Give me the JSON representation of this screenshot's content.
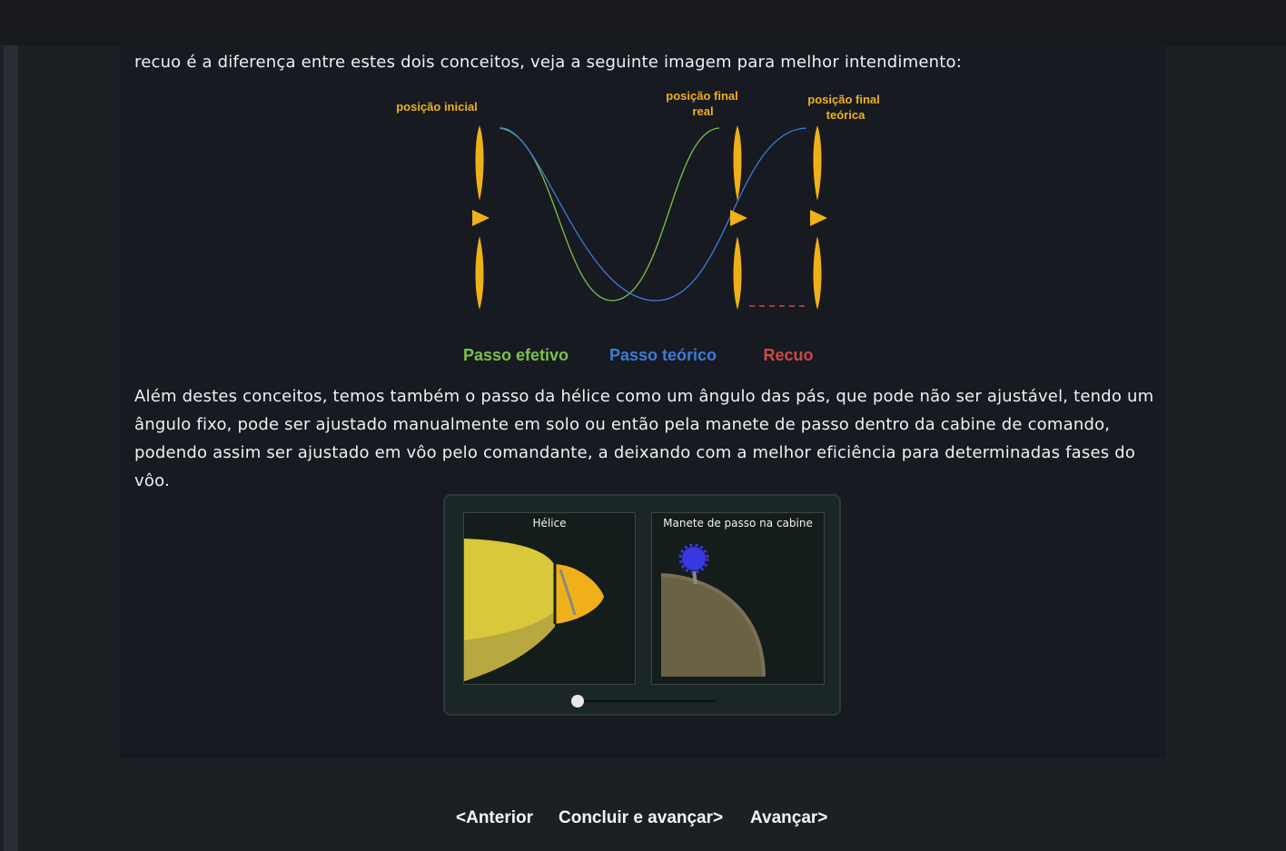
{
  "content": {
    "para1": "recuo é a diferença entre estes dois conceitos, veja a seguinte imagem para melhor intendimento:",
    "para2": "  Além destes conceitos, temos também o passo da hélice como um ângulo das pás, que pode não ser ajustável, tendo um ângulo fixo, pode ser ajustado manualmente em solo ou então pela manete de passo dentro da cabine de comando, podendo assim ser ajustado em vôo pelo comandante, a deixando com a melhor eficiência para determinadas fases do vôo."
  },
  "diagram": {
    "label_initial": "posição inicial",
    "label_final_real_1": "posição final",
    "label_final_real_2": "real",
    "label_final_theoretical_1": "posição final",
    "label_final_theoretical_2": "teórica",
    "legend_effective": "Passo efetivo",
    "legend_theoretical": "Passo teórico",
    "legend_slip": "Recuo",
    "colors": {
      "propeller": "#f0b01a",
      "effective": "#7cc245",
      "theoretical": "#3b7bd8",
      "slip": "#d04848"
    }
  },
  "simulation": {
    "helice_title": "Hélice",
    "manete_title": "Manete de passo na cabine",
    "slider_value": 0
  },
  "nav": {
    "prev": "<Anterior",
    "done": "Concluir e avançar>",
    "next": "Avançar>"
  }
}
